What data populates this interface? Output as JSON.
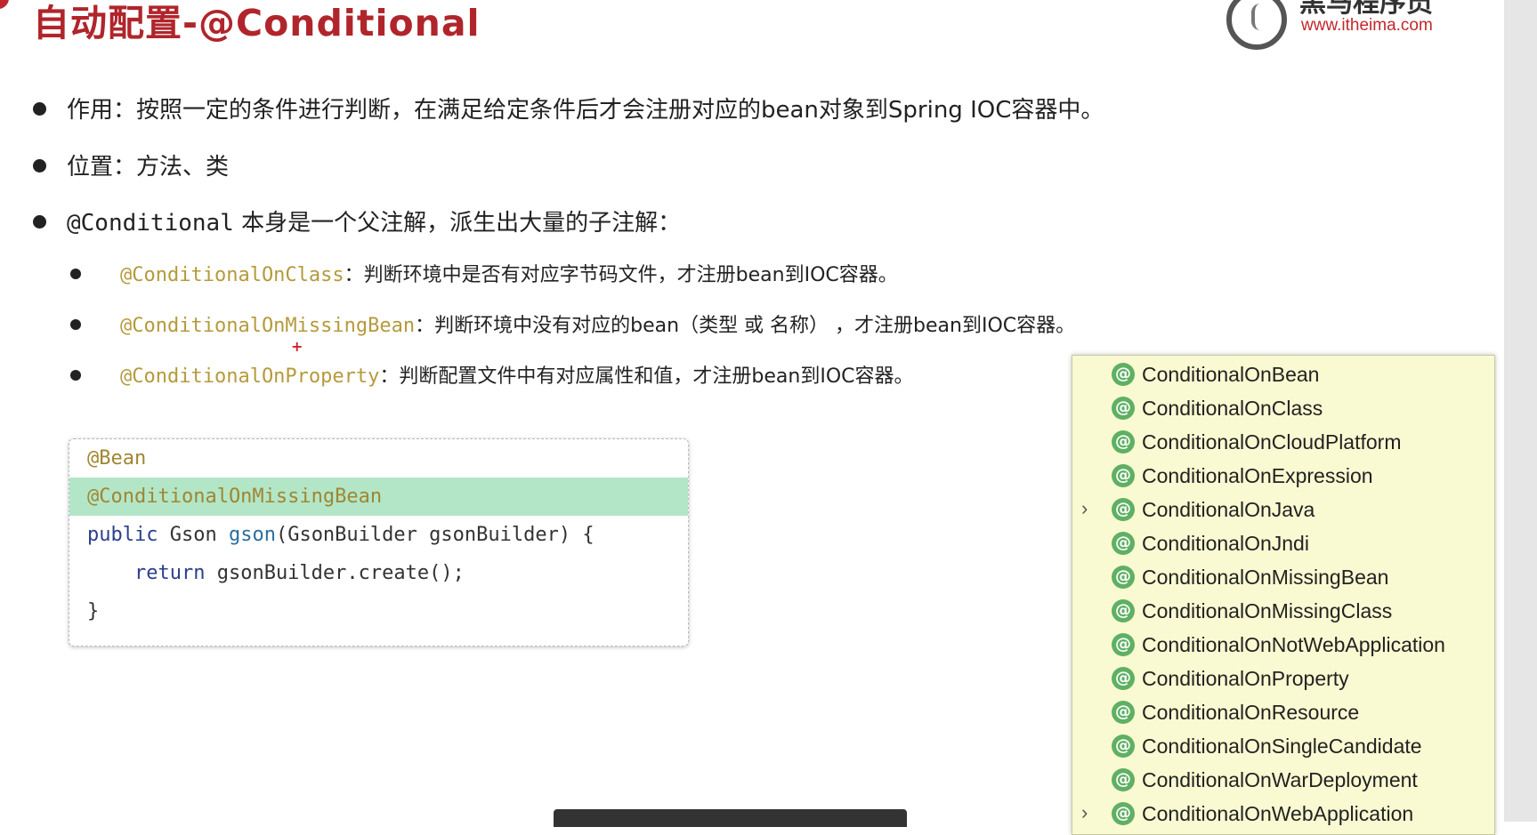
{
  "header": {
    "title": "自动配置-@Conditional",
    "logo_name": "黑马程序员",
    "logo_url": "www.itheima.com"
  },
  "bullets": [
    {
      "text": "作用：按照一定的条件进行判断，在满足给定条件后才会注册对应的bean对象到Spring IOC容器中。"
    },
    {
      "text": "位置：方法、类"
    },
    {
      "code": "@Conditional",
      "text": " 本身是一个父注解，派生出大量的子注解："
    }
  ],
  "sub_bullets": [
    {
      "annotation": "@ConditionalOnClass",
      "text": "：判断环境中是否有对应字节码文件，才注册bean到IOC容器。"
    },
    {
      "annotation": "@ConditionalOnMissingBean",
      "text": "：判断环境中没有对应的bean（类型 或 名称） ，才注册bean到IOC容器。"
    },
    {
      "annotation": "@ConditionalOnProperty",
      "text": "：判断配置文件中有对应属性和值，才注册bean到IOC容器。"
    }
  ],
  "code": {
    "line1": "@Bean",
    "line2": "@ConditionalOnMissingBean",
    "line3_kw": "public",
    "line3_type": " Gson ",
    "line3_fn": "gson",
    "line3_rest": "(GsonBuilder gsonBuilder) {",
    "line4_kw": "return",
    "line4_rest": " gsonBuilder.create();",
    "line5": "}"
  },
  "popup": {
    "icon_glyph": "@",
    "expand_glyph": "›",
    "items": [
      {
        "label": "ConditionalOnBean",
        "expandable": false
      },
      {
        "label": "ConditionalOnClass",
        "expandable": false
      },
      {
        "label": "ConditionalOnCloudPlatform",
        "expandable": false
      },
      {
        "label": "ConditionalOnExpression",
        "expandable": false
      },
      {
        "label": "ConditionalOnJava",
        "expandable": true
      },
      {
        "label": "ConditionalOnJndi",
        "expandable": false
      },
      {
        "label": "ConditionalOnMissingBean",
        "expandable": false
      },
      {
        "label": "ConditionalOnMissingClass",
        "expandable": false
      },
      {
        "label": "ConditionalOnNotWebApplication",
        "expandable": false
      },
      {
        "label": "ConditionalOnProperty",
        "expandable": false
      },
      {
        "label": "ConditionalOnResource",
        "expandable": false
      },
      {
        "label": "ConditionalOnSingleCandidate",
        "expandable": false
      },
      {
        "label": "ConditionalOnWarDeployment",
        "expandable": false
      },
      {
        "label": "ConditionalOnWebApplication",
        "expandable": true
      }
    ]
  },
  "colors": {
    "title": "#b0252b",
    "annotation": "#b59a3c",
    "highlight_row": "#b3e6c7",
    "popup_bg": "#fafad2",
    "annotation_icon": "#5fb063"
  }
}
